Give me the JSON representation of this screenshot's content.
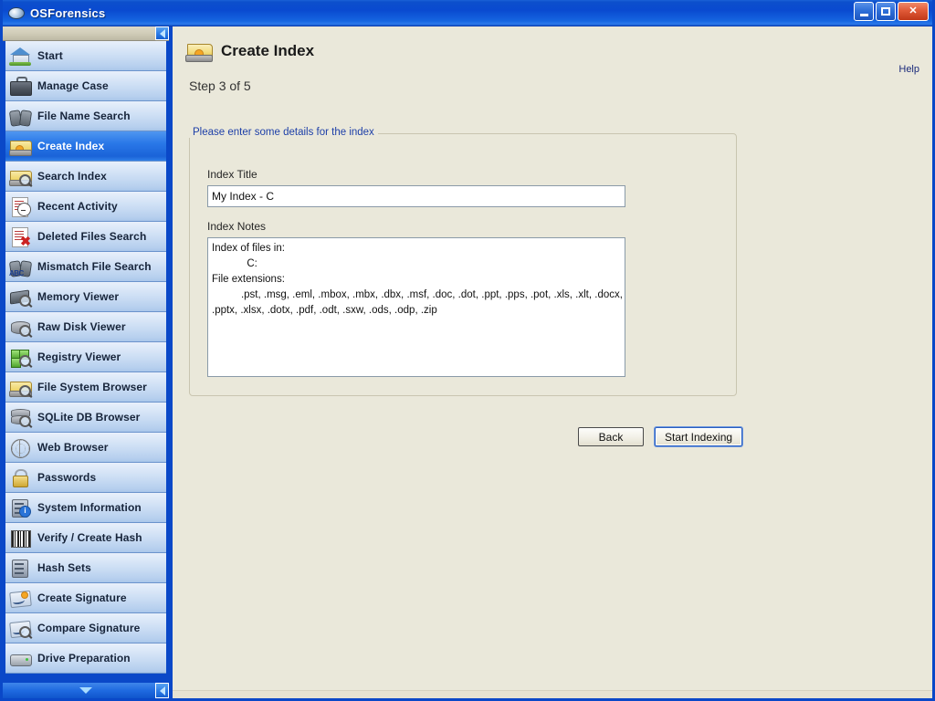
{
  "window": {
    "title": "OSForensics",
    "icon": "osforensics-disc-icon",
    "controls": {
      "minimize_label": "Minimize",
      "maximize_label": "Maximize",
      "close_label": "Close",
      "close_glyph": "✕"
    },
    "frame_color": "#0a48c8",
    "titlebar_color": "#0a4ad0",
    "background_color": "#eae8da"
  },
  "sidebar": {
    "scroll_up_tab": "collapse-panel",
    "scroll_down_arrow": "scroll-down",
    "selected_index": 3,
    "items": [
      {
        "label": "Start",
        "icon": "home-icon"
      },
      {
        "label": "Manage Case",
        "icon": "briefcase-icon"
      },
      {
        "label": "File Name Search",
        "icon": "binoculars-icon"
      },
      {
        "label": "Create Index",
        "icon": "folder-star-icon"
      },
      {
        "label": "Search Index",
        "icon": "folder-magnifier-icon"
      },
      {
        "label": "Recent Activity",
        "icon": "clock-document-icon"
      },
      {
        "label": "Deleted Files Search",
        "icon": "document-red-x-icon"
      },
      {
        "label": "Mismatch File Search",
        "icon": "binoculars-abc-icon"
      },
      {
        "label": "Memory Viewer",
        "icon": "memory-chip-magnifier-icon"
      },
      {
        "label": "Raw Disk Viewer",
        "icon": "disk-magnifier-icon"
      },
      {
        "label": "Registry Viewer",
        "icon": "registry-blocks-magnifier-icon"
      },
      {
        "label": "File System Browser",
        "icon": "folder-magnifier-icon"
      },
      {
        "label": "SQLite DB Browser",
        "icon": "database-magnifier-icon"
      },
      {
        "label": "Web Browser",
        "icon": "web-globe-icon"
      },
      {
        "label": "Passwords",
        "icon": "padlock-icon"
      },
      {
        "label": "System Information",
        "icon": "server-info-icon"
      },
      {
        "label": "Verify / Create Hash",
        "icon": "barcode-icon"
      },
      {
        "label": "Hash Sets",
        "icon": "server-stack-icon"
      },
      {
        "label": "Create Signature",
        "icon": "signature-star-icon"
      },
      {
        "label": "Compare Signature",
        "icon": "signature-magnifier-icon"
      },
      {
        "label": "Drive Preparation",
        "icon": "hard-drive-icon"
      }
    ]
  },
  "main": {
    "page_title": "Create Index",
    "page_icon": "folder-star-icon",
    "help_label": "Help",
    "step_label": "Step 3 of 5",
    "group_legend": "Please enter some details for the index",
    "legend_color": "#1d3fa8",
    "fields": {
      "index_title": {
        "label": "Index Title",
        "value": "My Index - C",
        "placeholder": ""
      },
      "index_notes": {
        "label": "Index Notes",
        "value": "Index of files in:\n            C:\nFile extensions:\n          .pst, .msg, .eml, .mbox, .mbx, .dbx, .msf, .doc, .dot, .ppt, .pps, .pot, .xls, .xlt, .docx,\n.pptx, .xlsx, .dotx, .pdf, .odt, .sxw, .ods, .odp, .zip",
        "placeholder": ""
      }
    },
    "buttons": {
      "back": "Back",
      "start_indexing": "Start Indexing"
    }
  }
}
